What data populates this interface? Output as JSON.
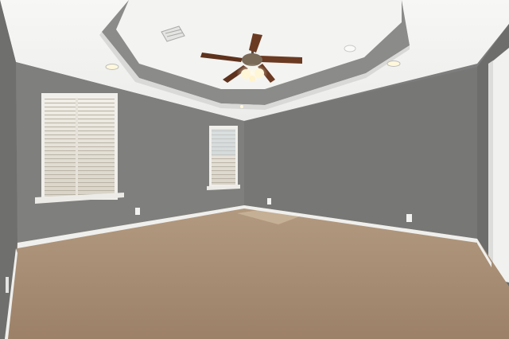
{
  "scene": {
    "subject": "empty-bedroom",
    "features": [
      "tray-ceiling",
      "ceiling-fan",
      "two-windows",
      "carpet-floor",
      "recessed-lights"
    ],
    "colors": {
      "wall_left": "#7e7e7c",
      "wall_back": "#767676",
      "wall_right": "#6f6f6f",
      "ceiling": "#f4f4f2",
      "tray": "#8a8a88",
      "carpet": "#a58b72",
      "trim": "#f2f2f0",
      "fan_wood": "#6b3a22"
    }
  }
}
